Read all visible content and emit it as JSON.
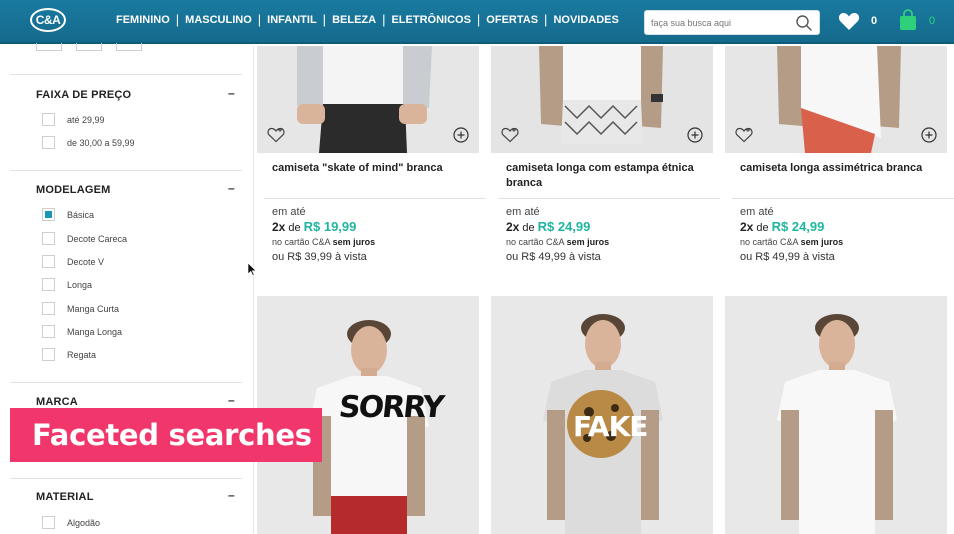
{
  "header": {
    "logo_text": "C&A",
    "nav": [
      "FEMININO",
      "MASCULINO",
      "INFANTIL",
      "BELEZA",
      "ELETRÔNICOS",
      "OFERTAS",
      "NOVIDADES"
    ],
    "nav_separator": "|",
    "search_placeholder": "faça sua busca aqui",
    "favorites_count": "0",
    "bag_count": "0",
    "colors": {
      "bar": "#1a7aa0",
      "bag": "#2fd07a"
    }
  },
  "sidebar": {
    "facets": [
      {
        "title": "FAIXA DE PREÇO",
        "toggle": "–",
        "options": [
          {
            "label": "até 29,99",
            "checked": false
          },
          {
            "label": "de 30,00 a 59,99",
            "checked": false
          }
        ]
      },
      {
        "title": "MODELAGEM",
        "toggle": "–",
        "options": [
          {
            "label": "Básica",
            "checked": true
          },
          {
            "label": "Decote Careca",
            "checked": false
          },
          {
            "label": "Decote V",
            "checked": false
          },
          {
            "label": "Longa",
            "checked": false
          },
          {
            "label": "Manga Curta",
            "checked": false
          },
          {
            "label": "Manga Longa",
            "checked": false
          },
          {
            "label": "Regata",
            "checked": false
          }
        ]
      },
      {
        "title": "MARCA",
        "toggle": "–",
        "options": []
      },
      {
        "title": "MATERIAL",
        "toggle": "–",
        "options": [
          {
            "label": "Algodão",
            "checked": false
          }
        ]
      }
    ],
    "check_color": "#1b96b6"
  },
  "products": [
    {
      "name": "camiseta \"skate of mind\" branca",
      "em_ate": "em até",
      "installments": "2x",
      "de": "de",
      "price": "R$ 19,99",
      "card_text": "no cartão C&A",
      "card_bold": "sem juros",
      "cash": "ou R$ 39,99 à vista"
    },
    {
      "name": "camiseta longa com estampa étnica branca",
      "em_ate": "em até",
      "installments": "2x",
      "de": "de",
      "price": "R$ 24,99",
      "card_text": "no cartão C&A",
      "card_bold": "sem juros",
      "cash": "ou R$ 49,99 à vista"
    },
    {
      "name": "camiseta longa assimétrica branca",
      "em_ate": "em até",
      "installments": "2x",
      "de": "de",
      "price": "R$ 24,99",
      "card_text": "no cartão C&A",
      "card_bold": "sem juros",
      "cash": "ou R$ 49,99 à vista"
    }
  ],
  "row2_prints": [
    "SORRY",
    "FAKE",
    ""
  ],
  "price_color": "#1fb5a0",
  "caption": {
    "text": "Faceted searches",
    "color": "#f0366b"
  }
}
